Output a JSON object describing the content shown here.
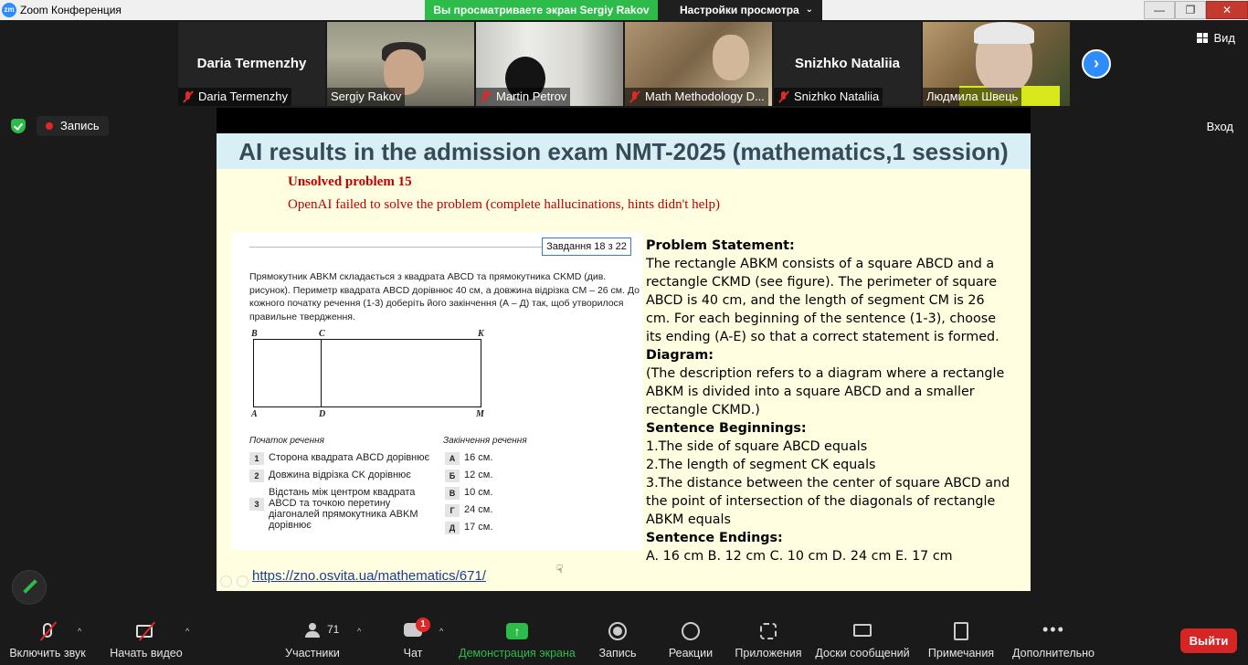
{
  "app": {
    "title": "Zoom Конференция",
    "icon_text": "zm"
  },
  "share_banner": {
    "status": "Вы просматриваете экран Sergiy Rakov",
    "options": "Настройки просмотра"
  },
  "window_controls": {
    "minimize": "—",
    "maximize": "❐",
    "close": "✕"
  },
  "participants": [
    {
      "big_name": "Daria Termenzhy",
      "name": "Daria Termenzhy",
      "muted": true
    },
    {
      "name": "Sergiy Rakov",
      "muted": false,
      "active": true
    },
    {
      "name": "Martin Petrov",
      "muted": true
    },
    {
      "name": "Math Methodology D...",
      "muted": true
    },
    {
      "big_name": "Snizhko Nataliia",
      "name": "Snizhko Nataliia",
      "muted": true
    },
    {
      "name": "Людмила Швець",
      "muted": false
    }
  ],
  "view_label": "Вид",
  "recording_label": "Запись",
  "enter_label": "Вход",
  "slide": {
    "title": "AI results in the admission exam NMT-2025 (mathematics,1 session)",
    "unsolved": "Unsolved problem 15",
    "note": "OpenAI failed to solve the problem (complete hallucinations, hints didn't help)",
    "task": {
      "counter": "Завдання 18 з 22",
      "text": "Прямокутник ABKM складається з квадрата ABCD та прямокутника CKMD (див. рисунок). Периметр квадрата ABCD дорівнює 40 см, а довжина відрізка CM – 26 см. До кожного початку речення (1-3) доберіть його закінчення (А – Д) так, щоб утворилося правильне твердження.",
      "points": {
        "b": "B",
        "c": "C",
        "k": "K",
        "a": "A",
        "d": "D",
        "m": "M"
      },
      "begin_header": "Початок речення",
      "end_header": "Закінчення речення",
      "beginnings": [
        {
          "n": "1",
          "text": "Сторона квадрата ABCD дорівнює"
        },
        {
          "n": "2",
          "text": "Довжина відрізка CK дорівнює"
        },
        {
          "n": "3",
          "text": "Відстань між центром квадрата ABCD та точкою перетину діагоналей прямокутника ABKM дорівнює"
        }
      ],
      "endings": [
        {
          "l": "А",
          "text": "16 см."
        },
        {
          "l": "Б",
          "text": "12 см."
        },
        {
          "l": "В",
          "text": "10 см."
        },
        {
          "l": "Г",
          "text": "24 см."
        },
        {
          "l": "Д",
          "text": "17 см."
        }
      ]
    },
    "statement": {
      "h1": "Problem Statement:",
      "p1": "The rectangle ABKM consists of a square ABCD and a rectangle CKMD (see figure). The perimeter of square ABCD is 40 cm, and the length of segment CM is 26 cm. For each beginning of the sentence (1-3), choose its ending (A-E) so that a correct statement is formed.",
      "h2": "Diagram:",
      "p2": "(The description refers to a diagram where a rectangle ABKM is divided into a square ABCD and a smaller rectangle CKMD.)",
      "h3": "Sentence Beginnings:",
      "s1": "1.The side of square ABCD equals",
      "s2": "2.The length of segment CK equals",
      "s3": "3.The distance between the center of square ABCD and the point of intersection of the diagonals of rectangle ABKM equals",
      "h4": "Sentence Endings:",
      "endings": "A. 16 cm B. 12 cm C. 10 cm D. 24 cm E. 17 cm"
    },
    "link": "https://zno.osvita.ua/mathematics/671/"
  },
  "toolbar": {
    "mic": "Включить звук",
    "video": "Начать видео",
    "participants": "Участники",
    "participants_count": "71",
    "chat": "Чат",
    "chat_badge": "1",
    "share": "Демонстрация экрана",
    "record": "Запись",
    "reactions": "Реакции",
    "apps": "Приложения",
    "whiteboards": "Доски сообщений",
    "notes": "Примечания",
    "more": "Дополнительно",
    "leave": "Выйти"
  },
  "colors": {
    "accent": "#2d8cff",
    "share_green": "#2dbb4a",
    "leave_red": "#d72424",
    "slide_bg": "#fffee0",
    "title_bg": "#d8f0f5",
    "note_red": "#c00000"
  }
}
